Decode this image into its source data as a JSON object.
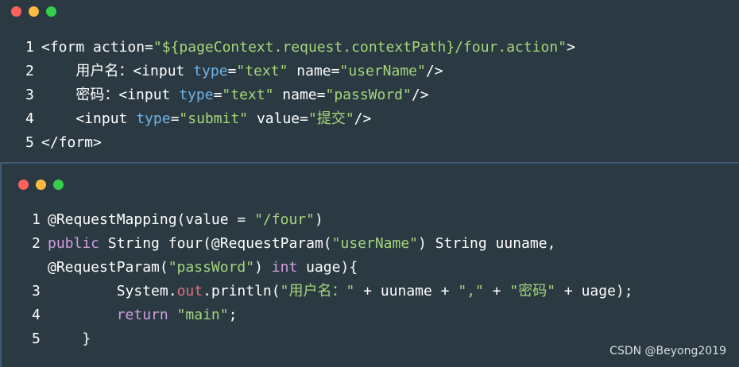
{
  "snippet1": {
    "lines": [
      {
        "num": "1",
        "parts": [
          {
            "t": "<form action=",
            "c": "t"
          },
          {
            "t": "\"${pageContext.request.contextPath}/four.action\"",
            "c": "s"
          },
          {
            "t": ">",
            "c": "t"
          }
        ]
      },
      {
        "num": "2",
        "parts": [
          {
            "t": "    用户名：<input ",
            "c": "t"
          },
          {
            "t": "type",
            "c": "a"
          },
          {
            "t": "=",
            "c": "t"
          },
          {
            "t": "\"text\"",
            "c": "s"
          },
          {
            "t": " name=",
            "c": "t"
          },
          {
            "t": "\"userName\"",
            "c": "s"
          },
          {
            "t": "/>",
            "c": "t"
          }
        ]
      },
      {
        "num": "3",
        "parts": [
          {
            "t": "    密码：<input ",
            "c": "t"
          },
          {
            "t": "type",
            "c": "a"
          },
          {
            "t": "=",
            "c": "t"
          },
          {
            "t": "\"text\"",
            "c": "s"
          },
          {
            "t": " name=",
            "c": "t"
          },
          {
            "t": "\"passWord\"",
            "c": "s"
          },
          {
            "t": "/>",
            "c": "t"
          }
        ]
      },
      {
        "num": "4",
        "parts": [
          {
            "t": "    <input ",
            "c": "t"
          },
          {
            "t": "type",
            "c": "a"
          },
          {
            "t": "=",
            "c": "t"
          },
          {
            "t": "\"submit\"",
            "c": "s"
          },
          {
            "t": " value=",
            "c": "t"
          },
          {
            "t": "\"提交\"",
            "c": "s"
          },
          {
            "t": "/>",
            "c": "t"
          }
        ]
      },
      {
        "num": "5",
        "parts": [
          {
            "t": "</form>",
            "c": "t"
          }
        ]
      }
    ]
  },
  "snippet2": {
    "lines": [
      {
        "num": "1",
        "parts": [
          {
            "t": "@RequestMapping(value = ",
            "c": "t"
          },
          {
            "t": "\"/four\"",
            "c": "s"
          },
          {
            "t": ")",
            "c": "t"
          }
        ]
      },
      {
        "num": "2",
        "parts": [
          {
            "t": "public",
            "c": "k"
          },
          {
            "t": " String four(@RequestParam(",
            "c": "t"
          },
          {
            "t": "\"userName\"",
            "c": "s"
          },
          {
            "t": ") String uuname,",
            "c": "t"
          }
        ]
      },
      {
        "num": "",
        "parts": [
          {
            "t": "@RequestParam(",
            "c": "t"
          },
          {
            "t": "\"passWord\"",
            "c": "s"
          },
          {
            "t": ") ",
            "c": "t"
          },
          {
            "t": "int",
            "c": "k"
          },
          {
            "t": " uage){",
            "c": "t"
          }
        ]
      },
      {
        "num": "3",
        "parts": [
          {
            "t": "        System.",
            "c": "t"
          },
          {
            "t": "out",
            "c": "o"
          },
          {
            "t": ".println(",
            "c": "t"
          },
          {
            "t": "\"用户名：\"",
            "c": "s"
          },
          {
            "t": " + uuname + ",
            "c": "t"
          },
          {
            "t": "\",\"",
            "c": "s"
          },
          {
            "t": " + ",
            "c": "t"
          },
          {
            "t": "\"密码\"",
            "c": "s"
          },
          {
            "t": " + uage);",
            "c": "t"
          }
        ]
      },
      {
        "num": "4",
        "parts": [
          {
            "t": "        ",
            "c": "t"
          },
          {
            "t": "return",
            "c": "k"
          },
          {
            "t": " ",
            "c": "t"
          },
          {
            "t": "\"main\"",
            "c": "s"
          },
          {
            "t": ";",
            "c": "t"
          }
        ]
      },
      {
        "num": "5",
        "parts": [
          {
            "t": "    }",
            "c": "t"
          }
        ]
      }
    ]
  },
  "watermark": "CSDN @Beyong2019"
}
